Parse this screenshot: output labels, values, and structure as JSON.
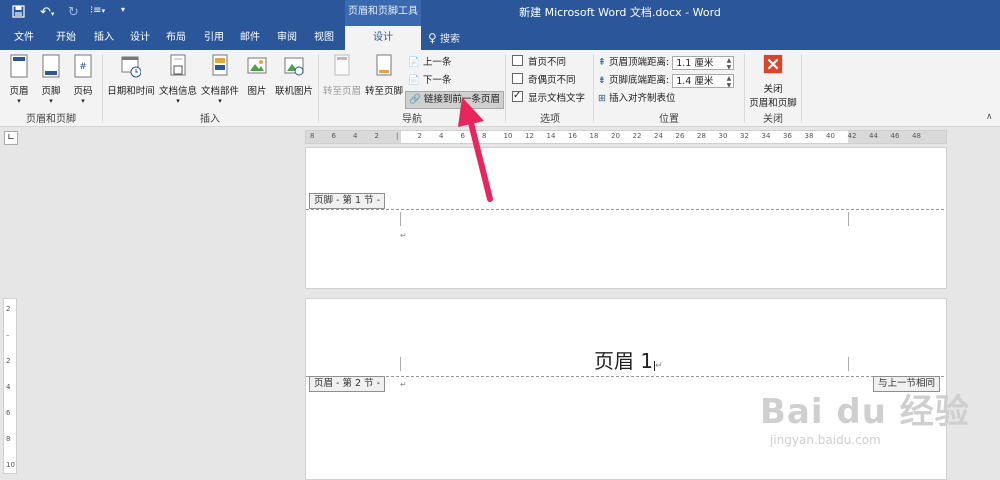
{
  "window": {
    "title": "新建 Microsoft Word 文档.docx  -  Word",
    "context_group": "页眉和页脚工具"
  },
  "tabs": [
    "文件",
    "开始",
    "插入",
    "设计",
    "布局",
    "引用",
    "邮件",
    "审阅",
    "视图",
    "设计"
  ],
  "search_label": "搜索",
  "ribbon": {
    "groups": {
      "header_footer": "页眉和页脚",
      "insert": "插入",
      "navigation": "导航",
      "options": "选项",
      "position": "位置",
      "close": "关闭"
    },
    "buttons": {
      "header": "页眉",
      "footer": "页脚",
      "page_number": "页码",
      "date_time": "日期和时间",
      "doc_info": "文档信息",
      "doc_parts": "文档部件",
      "picture": "图片",
      "online_picture": "联机图片",
      "goto_header": "转至页眉",
      "goto_footer": "转至页脚",
      "previous": "上一条",
      "next": "下一条",
      "link_previous": "链接到前一条页眉",
      "close_line1": "关闭",
      "close_line2": "页眉和页脚"
    },
    "options": {
      "diff_first": "首页不同",
      "diff_odd_even": "奇偶页不同",
      "show_doc_text": "显示文档文字",
      "show_doc_text_checked": true
    },
    "position": {
      "header_top_label": "页眉顶端距离:",
      "header_top_value": "1.1 厘米",
      "footer_bottom_label": "页脚底端距离:",
      "footer_bottom_value": "1.4 厘米",
      "insert_align_tab": "插入对齐制表位"
    }
  },
  "ruler": {
    "labels": [
      "8",
      "6",
      "4",
      "2",
      "",
      "2",
      "4",
      "6",
      "8",
      "10",
      "12",
      "14",
      "16",
      "18",
      "20",
      "22",
      "24",
      "26",
      "28",
      "30",
      "32",
      "34",
      "36",
      "38",
      "40",
      "42",
      "44",
      "46",
      "48"
    ]
  },
  "vertical_ruler": [
    "2",
    "",
    "2",
    "4",
    "6",
    "8",
    "10"
  ],
  "document": {
    "footer_tag_1": "页脚 - 第 1 节 -",
    "header_tag_2": "页眉 - 第 2 节 -",
    "same_as_previous": "与上一节相同",
    "header_text": "页眉 1",
    "para_mark": "↵"
  },
  "watermark": {
    "brand": "Bai du 经验",
    "url": "jingyan.baidu.com"
  },
  "colors": {
    "word_blue": "#2b579a",
    "arrow": "#e8265e",
    "close_red": "#d9442b"
  }
}
